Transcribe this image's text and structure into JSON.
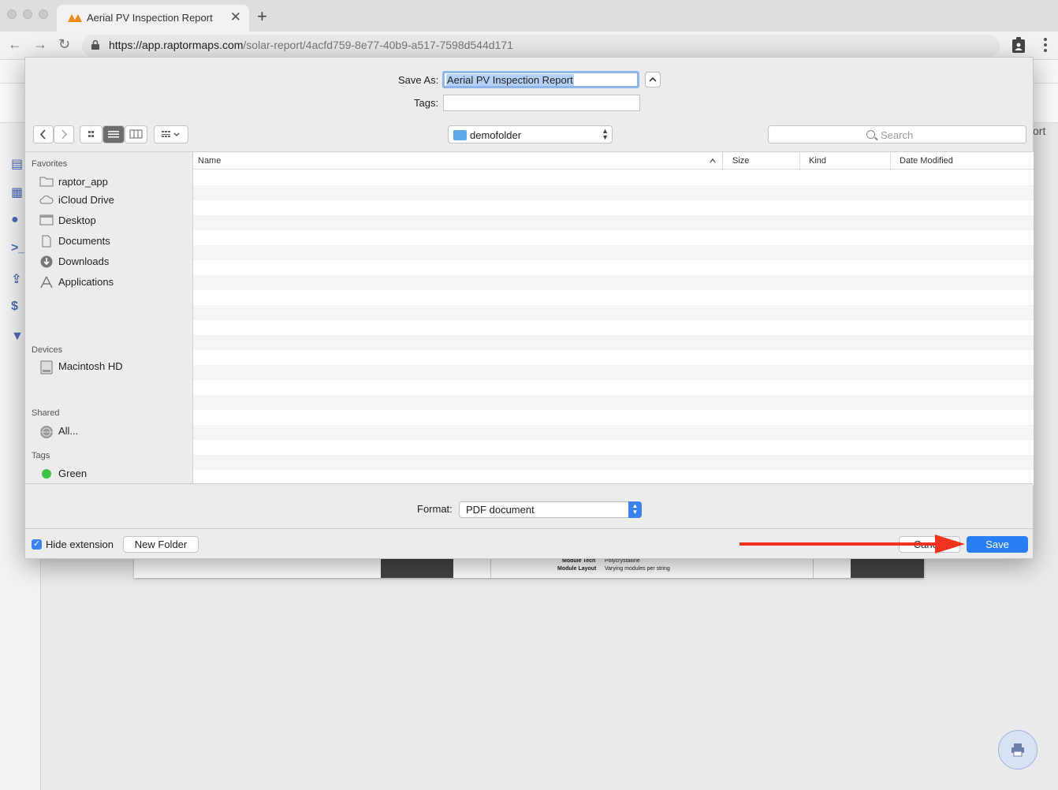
{
  "browser": {
    "tab_title": "Aerial PV Inspection Report",
    "url_host": "https://app.raptormaps.com",
    "url_path": "/solar-report/4acfd759-8e77-40b9-a517-7598d544d171",
    "new_tab_symbol": "+",
    "close_symbol": "✕"
  },
  "page": {
    "right_text": "ort",
    "report_rows": [
      {
        "label": "Module Tech",
        "value": "Polycrystalline"
      },
      {
        "label": "Module Layout",
        "value": "Varying modules per string"
      }
    ]
  },
  "dialog": {
    "save_as_label": "Save As:",
    "save_as_value": "Aerial PV Inspection Report",
    "tags_label": "Tags:",
    "tags_value": "",
    "current_folder": "demofolder",
    "search_placeholder": "Search",
    "sidebar": {
      "favorites_title": "Favorites",
      "favorites": [
        {
          "label": "raptor_app",
          "icon": "folder-icon"
        },
        {
          "label": "iCloud Drive",
          "icon": "cloud-icon"
        },
        {
          "label": "Desktop",
          "icon": "desktop-icon"
        },
        {
          "label": "Documents",
          "icon": "documents-icon"
        },
        {
          "label": "Downloads",
          "icon": "downloads-icon"
        },
        {
          "label": "Applications",
          "icon": "applications-icon"
        }
      ],
      "devices_title": "Devices",
      "devices": [
        {
          "label": "Macintosh HD",
          "icon": "hard-drive-icon"
        }
      ],
      "shared_title": "Shared",
      "shared": [
        {
          "label": "All...",
          "icon": "network-icon"
        }
      ],
      "tags_title": "Tags",
      "tags": [
        {
          "label": "Green",
          "color": "#3fc142"
        }
      ]
    },
    "columns": [
      "Name",
      "Size",
      "Kind",
      "Date Modified"
    ],
    "format_label": "Format:",
    "format_value": "PDF document",
    "hide_extension_label": "Hide extension",
    "hide_extension_checked": true,
    "new_folder_label": "New Folder",
    "cancel_label": "Cancel",
    "save_label": "Save"
  },
  "colors": {
    "accent": "#2a7ef5",
    "annotation_arrow": "#f0321e",
    "sidebar_icons": "#4b6cb7"
  }
}
